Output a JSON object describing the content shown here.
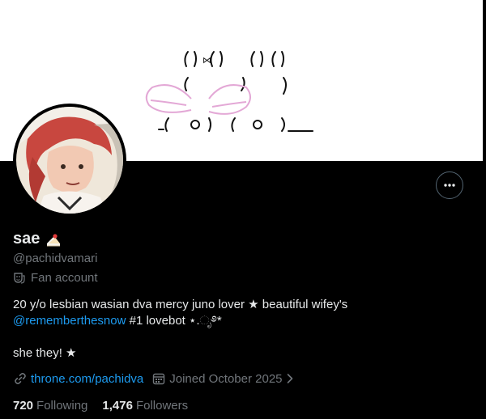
{
  "profile": {
    "name": "sae",
    "name_emoji": "cake-emoji",
    "handle": "@pachidvamari",
    "category": "Fan account",
    "bio_line1_text": "20 y/o lesbian wasian dva mercy juno lover ★ beautiful wifey's",
    "bio_mention": "@rememberthesnow",
    "bio_line2_rest": " #1 lovebot ⋆.ೃ࿔*",
    "bio_line3": "she they! ★",
    "website": "throne.com/pachidva",
    "joined": "Joined October 2025",
    "following_count": "720",
    "following_label": "Following",
    "followers_count": "1,476",
    "followers_label": "Followers"
  },
  "icons": {
    "more": "more-horizontal-icon",
    "category": "theater-masks-icon",
    "website": "link-icon",
    "joined": "calendar-icon",
    "joined_chevron": "chevron-right-icon"
  },
  "colors": {
    "background": "#000000",
    "text_primary": "#e7e9ea",
    "text_secondary": "#71767b",
    "accent": "#1d9bf0",
    "banner": "#ffffff"
  }
}
